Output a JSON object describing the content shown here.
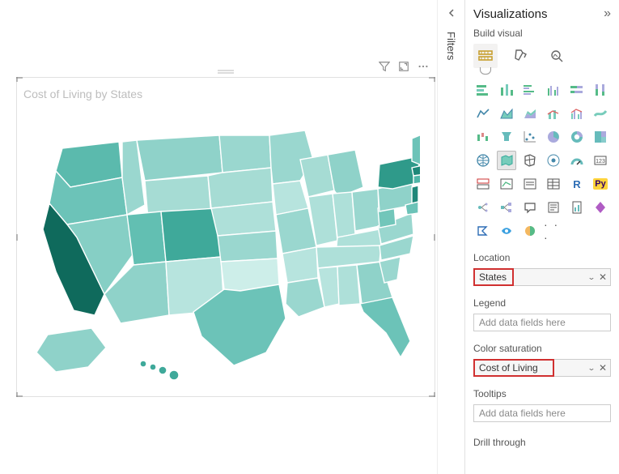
{
  "pane": {
    "title": "Visualizations",
    "subtitle": "Build visual"
  },
  "filters_rail": {
    "label": "Filters"
  },
  "visual": {
    "title": "Cost of Living by States"
  },
  "fields": {
    "location_label": "Location",
    "location_value": "States",
    "legend_label": "Legend",
    "legend_placeholder": "Add data fields here",
    "color_sat_label": "Color saturation",
    "color_sat_value": "Cost of Living",
    "tooltips_label": "Tooltips",
    "tooltips_placeholder": "Add data fields here",
    "drill_label": "Drill through"
  },
  "gallery": {
    "more": "· · ·",
    "r_label": "R",
    "py_label": "Py",
    "abc_label": "123"
  },
  "colors": {
    "teal1": "#4fb6a8",
    "teal2": "#6cc3b8",
    "teal3": "#8fd2c9",
    "teal4": "#aee0d9",
    "teal5": "#cdeee9",
    "dark": "#136b5d"
  }
}
